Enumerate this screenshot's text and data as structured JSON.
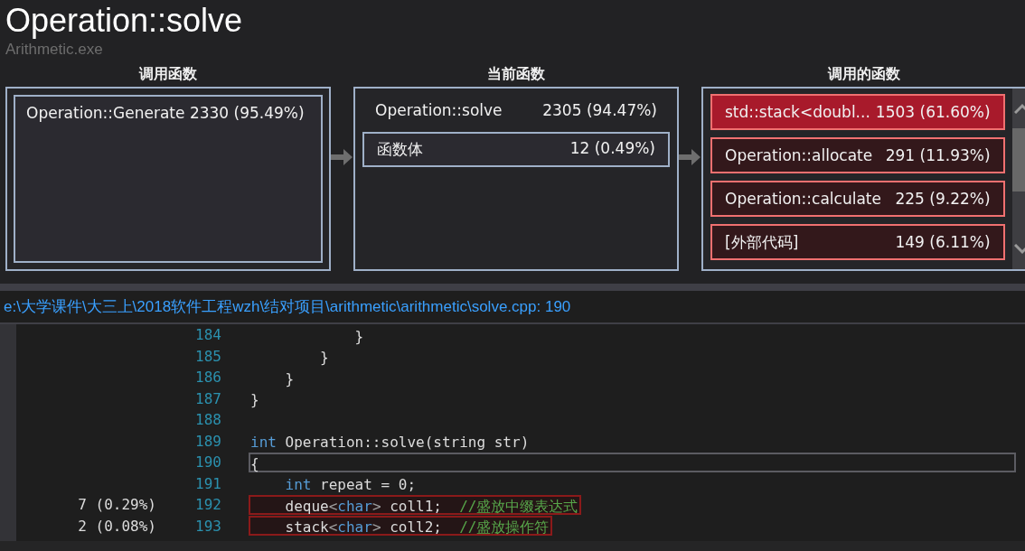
{
  "header": {
    "title": "Operation::solve",
    "process": "Arithmetic.exe"
  },
  "callers": {
    "heading": "调用函数",
    "items": [
      {
        "name": "Operation::Generate",
        "value": "2330 (95.49%)"
      }
    ]
  },
  "current": {
    "heading": "当前函数",
    "function": {
      "name": "Operation::solve",
      "value": "2305 (94.47%)"
    },
    "items": [
      {
        "name": "函数体",
        "value": "12 (0.49%)"
      }
    ]
  },
  "callees": {
    "heading": "调用的函数",
    "items": [
      {
        "name": "std::stack<doubl...",
        "value": "1503 (61.60%)",
        "selected": true
      },
      {
        "name": "Operation::allocate",
        "value": "291 (11.93%)",
        "selected": false
      },
      {
        "name": "Operation::calculate",
        "value": "225 (9.22%)",
        "selected": false
      },
      {
        "name": "[外部代码]",
        "value": "149 (6.11%)",
        "selected": false
      }
    ]
  },
  "file_path": "e:\\大学课件\\大三上\\2018软件工程wzh\\结对项目\\arithmetic\\arithmetic\\solve.cpp: 190",
  "code": {
    "lines": [
      {
        "number": "184",
        "current": false,
        "hot": false,
        "tokens": [
          {
            "kind": "plain",
            "text": "            }"
          }
        ]
      },
      {
        "number": "185",
        "current": false,
        "hot": false,
        "tokens": [
          {
            "kind": "plain",
            "text": "        }"
          }
        ]
      },
      {
        "number": "186",
        "current": false,
        "hot": false,
        "tokens": [
          {
            "kind": "plain",
            "text": "    }"
          }
        ]
      },
      {
        "number": "187",
        "current": false,
        "hot": false,
        "tokens": [
          {
            "kind": "plain",
            "text": "}"
          }
        ]
      },
      {
        "number": "188",
        "current": false,
        "hot": false
      },
      {
        "number": "189",
        "current": false,
        "hot": false,
        "tokens": [
          {
            "kind": "keyword",
            "text": "int"
          },
          {
            "kind": "plain",
            "text": " Operation::solve(string str)"
          }
        ]
      },
      {
        "number": "190",
        "current": true,
        "hot": false,
        "tokens": [
          {
            "kind": "plain",
            "text": "{"
          }
        ]
      },
      {
        "number": "191",
        "current": false,
        "hot": false,
        "tokens": [
          {
            "kind": "keyword",
            "text": "    int"
          },
          {
            "kind": "plain",
            "text": " repeat = 0;"
          }
        ]
      },
      {
        "number": "192",
        "sample": "7 (0.29%)",
        "current": false,
        "hot": true,
        "tokens": [
          {
            "kind": "plain",
            "text": "    deque"
          },
          {
            "kind": "bracket",
            "text": "<"
          },
          {
            "kind": "keyword",
            "text": "char"
          },
          {
            "kind": "bracket",
            "text": ">"
          },
          {
            "kind": "plain",
            "text": " coll1;  "
          },
          {
            "kind": "comment",
            "text": "//盛放中缀表达式"
          }
        ]
      },
      {
        "number": "193",
        "sample": "2 (0.08%)",
        "current": false,
        "hot": true,
        "tokens": [
          {
            "kind": "plain",
            "text": "    stack"
          },
          {
            "kind": "bracket",
            "text": "<"
          },
          {
            "kind": "keyword",
            "text": "char"
          },
          {
            "kind": "bracket",
            "text": ">"
          },
          {
            "kind": "plain",
            "text": " coll2;  "
          },
          {
            "kind": "comment",
            "text": "//盛放操作符"
          }
        ]
      }
    ]
  }
}
